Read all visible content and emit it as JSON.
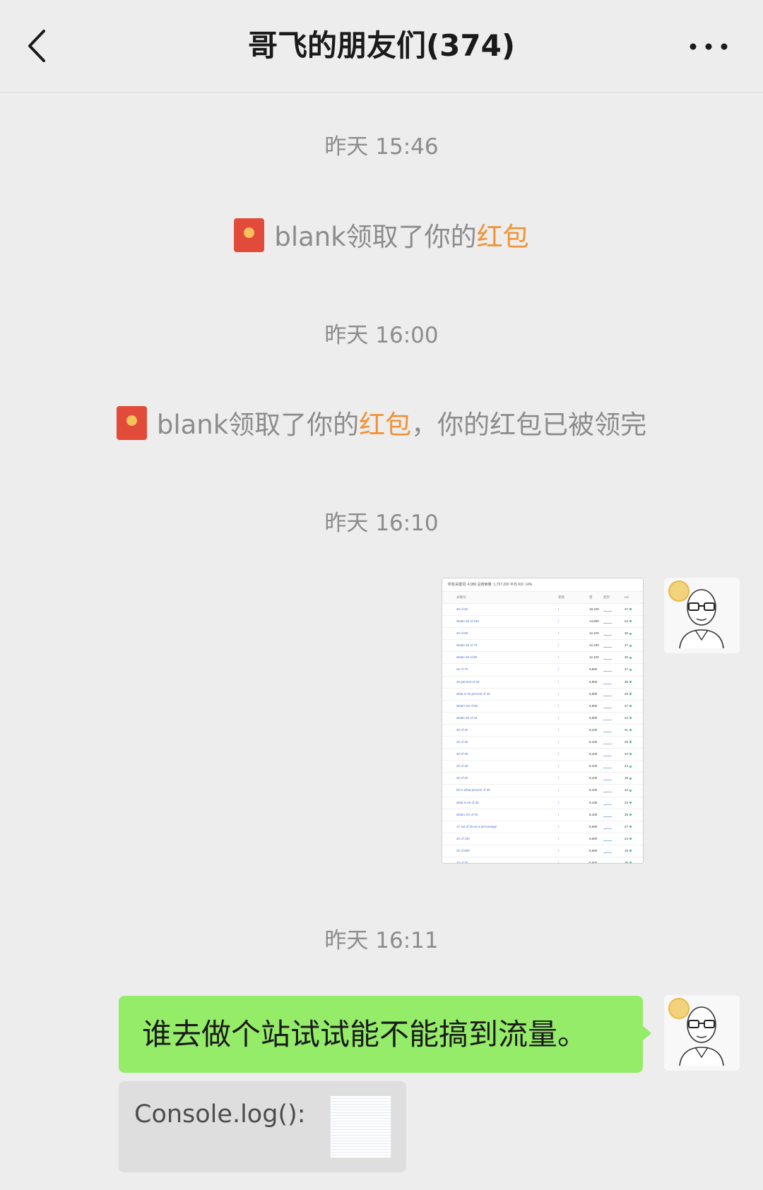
{
  "header": {
    "title": "哥飞的朋友们(374)",
    "back_icon": "chevron-left-icon",
    "more_icon": "more-dots-icon"
  },
  "messages": {
    "time1": "昨天 15:46",
    "sys1": {
      "icon": "red-packet-icon",
      "text": "blank领取了你的",
      "link": "红包"
    },
    "time2": "昨天 16:00",
    "sys2": {
      "icon": "red-packet-icon",
      "text": "blank领取了你的",
      "link": "红包",
      "suffix": "，你的红包已被领完"
    },
    "time3": "昨天 16:10",
    "time4": "昨天 16:11",
    "text_message": "谁去做个站试试能不能搞到流量。",
    "quote": {
      "text": "Console.log():"
    }
  },
  "screenshot_table": {
    "summary": "所有关键词: 4,980   总搜索量: 1,737,200   平均 KD: 14%",
    "columns": [
      "关键词",
      "意图",
      "量",
      "趋势",
      "KD"
    ],
    "rows": [
      {
        "keyword": "20 of 50",
        "intent": "I",
        "volume": "18,100",
        "kd": "27"
      },
      {
        "keyword": "whats 20 of 100",
        "intent": "I",
        "volume": "14,800",
        "kd": "22"
      },
      {
        "keyword": "20 of 80",
        "intent": "I",
        "volume": "12,100",
        "kd": "26"
      },
      {
        "keyword": "whats 20 of 70",
        "intent": "I",
        "volume": "12,100",
        "kd": "27"
      },
      {
        "keyword": "whats 20 of 80",
        "intent": "I",
        "volume": "12,100",
        "kd": "25"
      },
      {
        "keyword": "20 of 70",
        "intent": "I",
        "volume": "9,900",
        "kd": "27"
      },
      {
        "keyword": "40 percent of 20",
        "intent": "I",
        "volume": "9,900",
        "kd": "25"
      },
      {
        "keyword": "what is 40 percent of 20",
        "intent": "I",
        "volume": "9,900",
        "kd": "26"
      },
      {
        "keyword": "what's 20 of 80",
        "intent": "I",
        "volume": "9,900",
        "kd": "27"
      },
      {
        "keyword": "whats 20 of 40",
        "intent": "I",
        "volume": "9,900",
        "kd": "24"
      },
      {
        "keyword": "20 of 20",
        "intent": "I",
        "volume": "8,100",
        "kd": "21"
      },
      {
        "keyword": "20 of 25",
        "intent": "I",
        "volume": "8,100",
        "kd": "25"
      },
      {
        "keyword": "20 of 30",
        "intent": "I",
        "volume": "8,100",
        "kd": "24"
      },
      {
        "keyword": "20 of 40",
        "intent": "I",
        "volume": "8,100",
        "kd": "24"
      },
      {
        "keyword": "25 of 20",
        "intent": "I",
        "volume": "8,100",
        "kd": "19"
      },
      {
        "keyword": "60 is what percent of 20",
        "intent": "I",
        "volume": "8,100",
        "kd": "22"
      },
      {
        "keyword": "what is 20 of 30",
        "intent": "I",
        "volume": "8,100",
        "kd": "22"
      },
      {
        "keyword": "what's 20 of 70",
        "intent": "I",
        "volume": "8,100",
        "kd": "29"
      },
      {
        "keyword": "17 out of 20 as a percentage",
        "intent": "I",
        "volume": "6,600",
        "kd": "27"
      },
      {
        "keyword": "20 of 100",
        "intent": "I",
        "volume": "6,600",
        "kd": "24"
      },
      {
        "keyword": "20 of 500",
        "intent": "I",
        "volume": "6,600",
        "kd": "15"
      },
      {
        "keyword": "20 of 75",
        "intent": "I",
        "volume": "6,600",
        "kd": "26"
      },
      {
        "keyword": "20 percent of 60",
        "intent": "I",
        "volume": "6,600",
        "kd": "29"
      }
    ]
  },
  "colors": {
    "background": "#ededed",
    "bubble_green": "#95ec69",
    "link_orange": "#f09334",
    "red_packet": "#e24b3a"
  }
}
